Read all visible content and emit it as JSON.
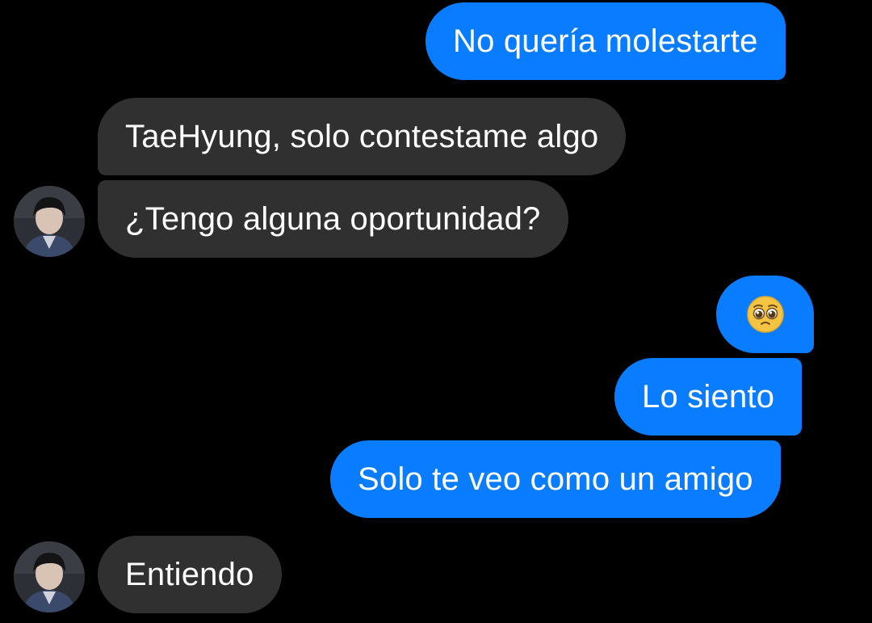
{
  "conversation": {
    "messages": [
      {
        "sender": "me",
        "text": "No quería molestarte"
      },
      {
        "sender": "other",
        "text": "TaeHyung, solo contestame algo"
      },
      {
        "sender": "other",
        "text": "¿Tengo alguna oportunidad?"
      },
      {
        "sender": "me",
        "emoji": "pleading-face"
      },
      {
        "sender": "me",
        "text": "Lo siento"
      },
      {
        "sender": "me",
        "text": "Solo te veo como un amigo"
      },
      {
        "sender": "other",
        "text": "Entiendo"
      }
    ]
  },
  "colors": {
    "background": "#000000",
    "sent_bubble": "#0a7cff",
    "received_bubble": "#303030",
    "text": "#ffffff"
  }
}
